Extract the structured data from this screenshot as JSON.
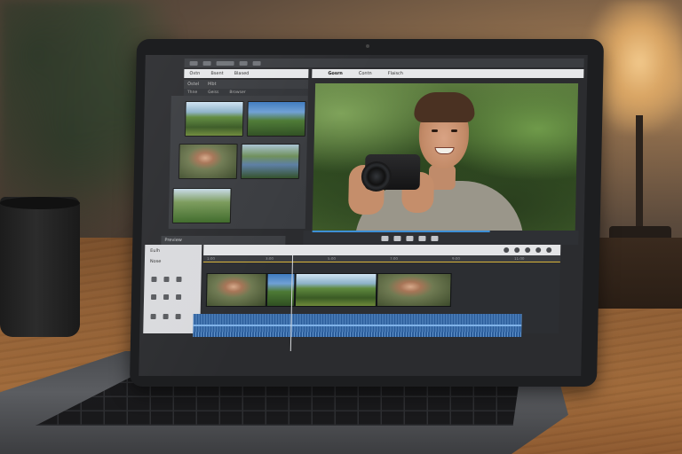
{
  "scene": {
    "description_colors": {
      "wall": "#5b4a3c",
      "desk": "#8f5e34",
      "lamp_glow": "#f2c98c",
      "laptop_frame": "#1d1e20",
      "accent_blue": "#3e8fd6",
      "audio_track": "#2a5c9a",
      "playhead_marker": "#d8b43a"
    }
  },
  "editor": {
    "media_tabs": [
      "Oxtn",
      "Bsent",
      "Blased"
    ],
    "media_subtabs": [
      "Ostel",
      "Mbt"
    ],
    "media_subtabs2": [
      "Thne",
      "Geiss",
      "Browser"
    ],
    "viewer_tabs": [
      "Gosrn",
      "Contn",
      "Flaisch"
    ],
    "timeline": {
      "header_items": [
        "Preview"
      ],
      "row_labels": [
        "Eulh",
        "Nose"
      ],
      "ruler_labels": [
        "1:00",
        "3:00",
        "5:00",
        "7:00",
        "9:00",
        "11:00"
      ]
    }
  }
}
